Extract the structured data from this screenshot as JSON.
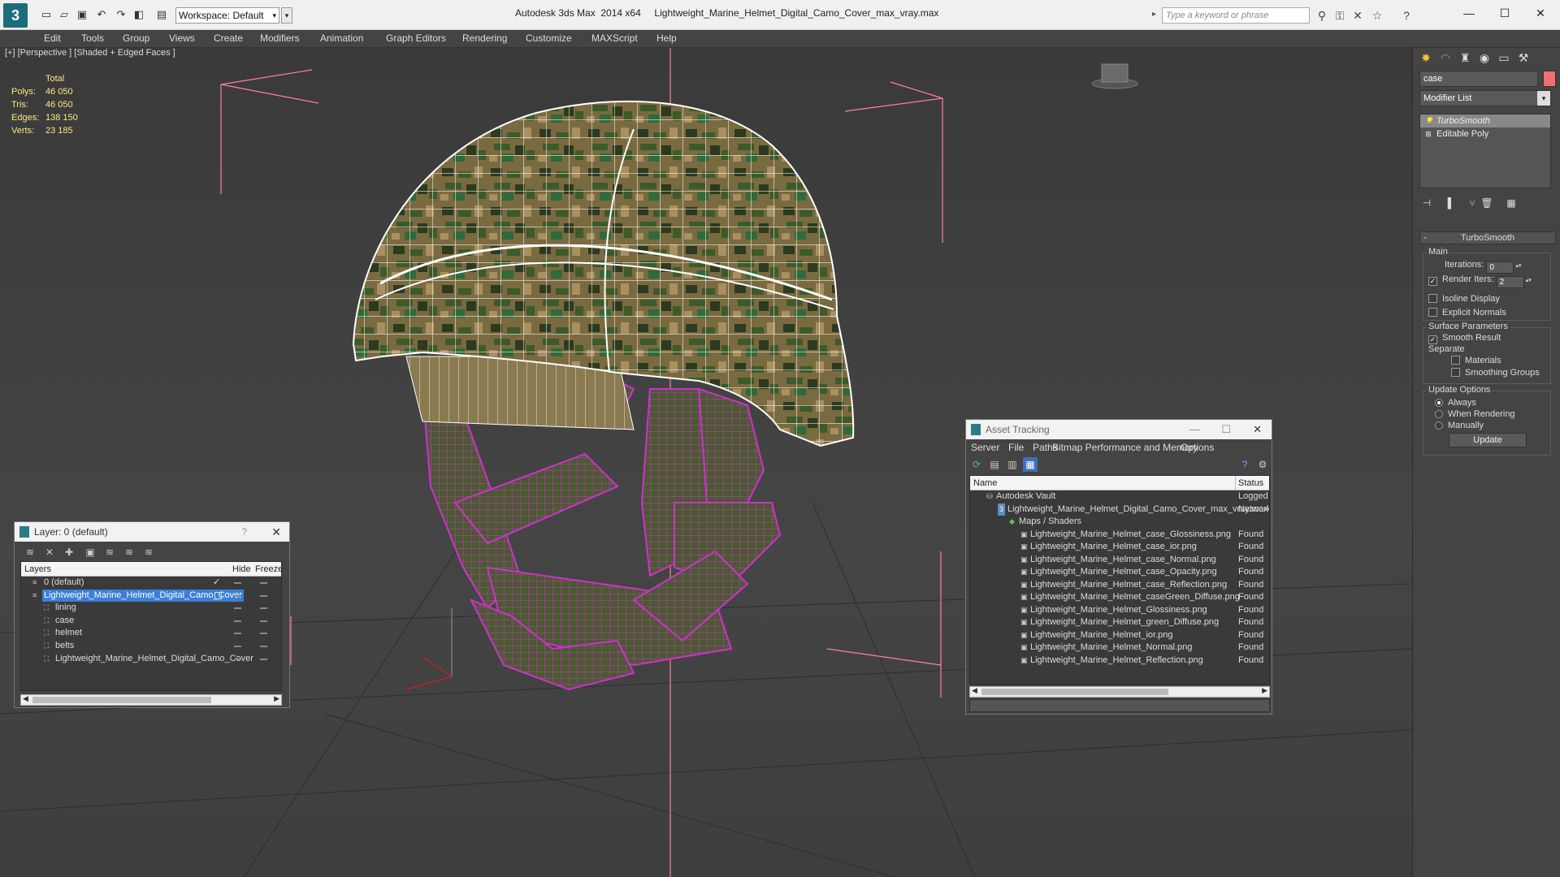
{
  "titlebar": {
    "workspace": "Workspace: Default",
    "title": "Autodesk 3ds Max  2014 x64     Lightweight_Marine_Helmet_Digital_Camo_Cover_max_vray.max",
    "search_placeholder": "Type a keyword or phrase"
  },
  "menu": [
    "Edit",
    "Tools",
    "Group",
    "Views",
    "Create",
    "Modifiers",
    "Animation",
    "Graph Editors",
    "Rendering",
    "Customize",
    "MAXScript",
    "Help"
  ],
  "viewport": {
    "label": "[+] [Perspective ] [Shaded + Edged Faces ]",
    "stats": {
      "header": "Total",
      "rows": [
        {
          "label": "Polys:",
          "value": "46 050"
        },
        {
          "label": "Tris:",
          "value": "46 050"
        },
        {
          "label": "Edges:",
          "value": "138 150"
        },
        {
          "label": "Verts:",
          "value": "23 185"
        }
      ]
    }
  },
  "command_panel": {
    "object_name": "case",
    "modifier_list": "Modifier List",
    "stack": [
      "TurboSmooth",
      "Editable Poly"
    ],
    "turbosmooth": {
      "title": "TurboSmooth",
      "main": "Main",
      "iterations_label": "Iterations:",
      "iterations": "0",
      "render_iters_label": "Render Iters:",
      "render_iters": "2",
      "isoline": "Isoline Display",
      "explicit": "Explicit Normals",
      "surface": "Surface Parameters",
      "smooth_result": "Smooth Result",
      "separate": "Separate",
      "materials": "Materials",
      "smoothing_groups": "Smoothing Groups",
      "update_options": "Update Options",
      "always": "Always",
      "when_rendering": "When Rendering",
      "manually": "Manually",
      "update": "Update"
    }
  },
  "layer_dialog": {
    "title": "Layer: 0 (default)",
    "help": "?",
    "columns": {
      "layers": "Layers",
      "hide": "Hide",
      "freeze": "Freeze"
    },
    "rows": [
      {
        "name": "0 (default)",
        "indent": 1,
        "checked": true
      },
      {
        "name": "Lightweight_Marine_Helmet_Digital_Camo_Cover",
        "indent": 1,
        "selected": true
      },
      {
        "name": "lining",
        "indent": 2
      },
      {
        "name": "case",
        "indent": 2
      },
      {
        "name": "helmet",
        "indent": 2
      },
      {
        "name": "belts",
        "indent": 2
      },
      {
        "name": "Lightweight_Marine_Helmet_Digital_Camo_Cover",
        "indent": 2
      }
    ]
  },
  "asset_dialog": {
    "title": "Asset Tracking",
    "menu": [
      "Server",
      "File",
      "Paths",
      "Bitmap Performance and Memory",
      "Options"
    ],
    "columns": {
      "name": "Name",
      "status": "Status"
    },
    "rows": [
      {
        "name": "Autodesk Vault",
        "indent": 1,
        "status": "Logged O"
      },
      {
        "name": "Lightweight_Marine_Helmet_Digital_Camo_Cover_max_vray.max",
        "indent": 2,
        "status": "Network"
      },
      {
        "name": "Maps / Shaders",
        "indent": 3,
        "status": ""
      },
      {
        "name": "Lightweight_Marine_Helmet_case_Glossiness.png",
        "indent": 4,
        "status": "Found"
      },
      {
        "name": "Lightweight_Marine_Helmet_case_ior.png",
        "indent": 4,
        "status": "Found"
      },
      {
        "name": "Lightweight_Marine_Helmet_case_Normal.png",
        "indent": 4,
        "status": "Found"
      },
      {
        "name": "Lightweight_Marine_Helmet_case_Opacity.png",
        "indent": 4,
        "status": "Found"
      },
      {
        "name": "Lightweight_Marine_Helmet_case_Reflection.png",
        "indent": 4,
        "status": "Found"
      },
      {
        "name": "Lightweight_Marine_Helmet_caseGreen_Diffuse.png",
        "indent": 4,
        "status": "Found"
      },
      {
        "name": "Lightweight_Marine_Helmet_Glossiness.png",
        "indent": 4,
        "status": "Found"
      },
      {
        "name": "Lightweight_Marine_Helmet_green_Diffuse.png",
        "indent": 4,
        "status": "Found"
      },
      {
        "name": "Lightweight_Marine_Helmet_ior.png",
        "indent": 4,
        "status": "Found"
      },
      {
        "name": "Lightweight_Marine_Helmet_Normal.png",
        "indent": 4,
        "status": "Found"
      },
      {
        "name": "Lightweight_Marine_Helmet_Reflection.png",
        "indent": 4,
        "status": "Found"
      }
    ]
  },
  "colors": {
    "selection": "#3c7fd6",
    "wire_magenta": "#d030d0",
    "stats_yellow": "#ffe680",
    "object_color": "#f07070"
  }
}
